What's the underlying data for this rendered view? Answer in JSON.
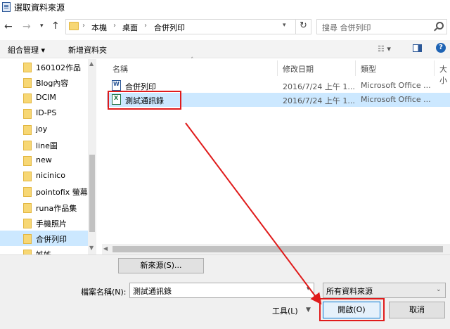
{
  "window": {
    "title": "選取資料來源"
  },
  "address": {
    "breadcrumbs": [
      "本機",
      "桌面",
      "合併列印"
    ],
    "search_placeholder": "搜尋 合併列印"
  },
  "toolbar": {
    "organize_label": "組合管理 ▾",
    "new_folder_label": "新增資料夾"
  },
  "nav": {
    "items": [
      {
        "label": "160102作品"
      },
      {
        "label": "Blog內容"
      },
      {
        "label": "DCIM"
      },
      {
        "label": "ID-PS"
      },
      {
        "label": "joy"
      },
      {
        "label": "line圖"
      },
      {
        "label": "new"
      },
      {
        "label": "nicinico"
      },
      {
        "label": "pointofix 螢幕"
      },
      {
        "label": "runa作品集"
      },
      {
        "label": "手機照片"
      },
      {
        "label": "合併列印"
      },
      {
        "label": "姊姊"
      }
    ],
    "selected_index": 11
  },
  "filelist": {
    "columns": [
      "名稱",
      "修改日期",
      "類型",
      "大小"
    ],
    "rows": [
      {
        "name": "合併列印",
        "date": "2016/7/24 上午 1...",
        "type": "Microsoft Office ...",
        "icon": "word-doc-icon"
      },
      {
        "name": "測試通訊錄",
        "date": "2016/7/24 上午 1...",
        "type": "Microsoft Office ...",
        "icon": "excel-doc-icon"
      }
    ],
    "selected_index": 1
  },
  "bottom": {
    "new_source_label": "新來源(S)...",
    "filename_label": "檔案名稱(N):",
    "filename_value": "測試通訊錄",
    "filetype_value": "所有資料來源",
    "tools_label": "工具(L)",
    "open_label": "開啟(O)",
    "cancel_label": "取消"
  },
  "colors": {
    "selection": "#cce8ff",
    "highlight": "#e01b1b",
    "folder": "#f7d774"
  }
}
